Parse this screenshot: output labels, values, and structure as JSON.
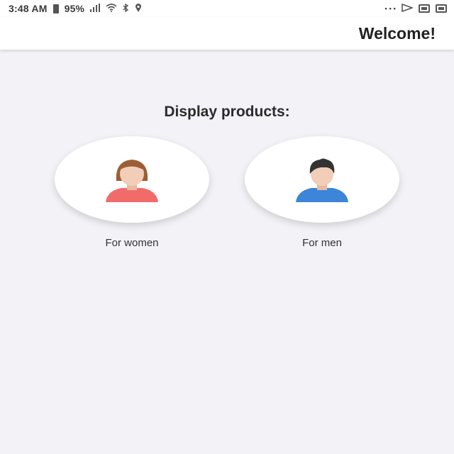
{
  "status_bar": {
    "time": "3:48 AM",
    "battery": "95%",
    "icons": [
      "location-icon",
      "bluetooth-icon",
      "wifi-icon",
      "signal-icon",
      "battery-icon",
      "more-icon",
      "gallery-icon",
      "mail-icon",
      "image-icon"
    ],
    "more": "• • •"
  },
  "app_bar": {
    "title": "Welcome!"
  },
  "main": {
    "section_title": "Display products:",
    "categories": [
      {
        "label": "For women",
        "icon": "woman-avatar-icon"
      },
      {
        "label": "For men",
        "icon": "man-avatar-icon"
      }
    ]
  },
  "colors": {
    "background": "#f2f2f7",
    "men_shirt": "#3d85d8",
    "women_shirt": "#f26b6b",
    "skin": "#f2cdb8",
    "men_hair": "#333333",
    "women_hair": "#9b5e35"
  }
}
